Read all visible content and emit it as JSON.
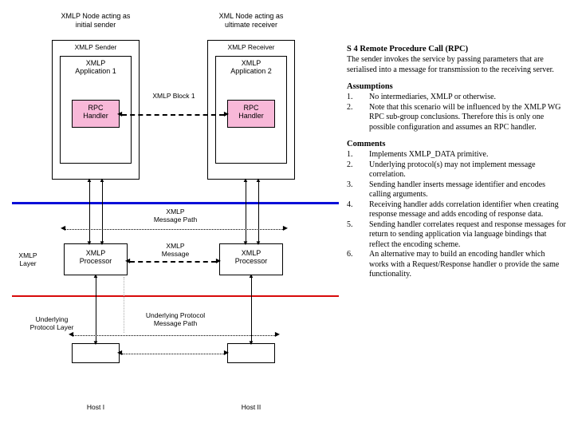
{
  "diagram": {
    "top_left": "XMLP Node acting as\ninitial sender",
    "top_right": "XML Node acting as\nultimate receiver",
    "sender": "XMLP Sender",
    "receiver": "XMLP Receiver",
    "app1": "XMLP\nApplication 1",
    "app2": "XMLP\nApplication 2",
    "rpc1": "RPC\nHandler",
    "rpc2": "RPC\nHandler",
    "block": "XMLP Block 1",
    "msg_path": "XMLP\nMessage Path",
    "msg": "XMLP\nMessage",
    "layer": "XMLP\nLayer",
    "proc1": "XMLP\nProcessor",
    "proc2": "XMLP\nProcessor",
    "ul": "Underlying\nProtocol Layer",
    "ul_path": "Underlying Protocol\nMessage Path",
    "host1": "Host I",
    "host2": "Host II"
  },
  "text": {
    "title": "S 4 Remote Procedure Call (RPC)",
    "intro": "The sender invokes the service by passing parameters that are serialised into a message for transmission to the receiving server.",
    "assump_h": "Assumptions",
    "assump": [
      {
        "n": "1.",
        "t": "No intermediaries, XMLP or otherwise."
      },
      {
        "n": "2.",
        "t": "Note that this scenario will be influenced by the XMLP WG RPC sub-group conclusions. Therefore this is only one possible configuration and assumes an RPC handler."
      }
    ],
    "comm_h": "Comments",
    "comm": [
      {
        "n": "1.",
        "t": "Implements XMLP_DATA primitive."
      },
      {
        "n": "2.",
        "t": "Underlying protocol(s) may not implement message correlation."
      },
      {
        "n": "3.",
        "t": "Sending handler inserts message identifier and encodes calling arguments."
      },
      {
        "n": "4.",
        "t": "Receiving handler adds correlation identifier when creating response message and adds encoding of response data."
      },
      {
        "n": "5.",
        "t": "Sending handler correlates request and response messages for return to sending application via language bindings that reflect the encoding scheme."
      },
      {
        "n": "6.",
        "t": "An alternative may to build an encoding handler which works with a Request/Response handler o provide the same functionality."
      }
    ]
  }
}
